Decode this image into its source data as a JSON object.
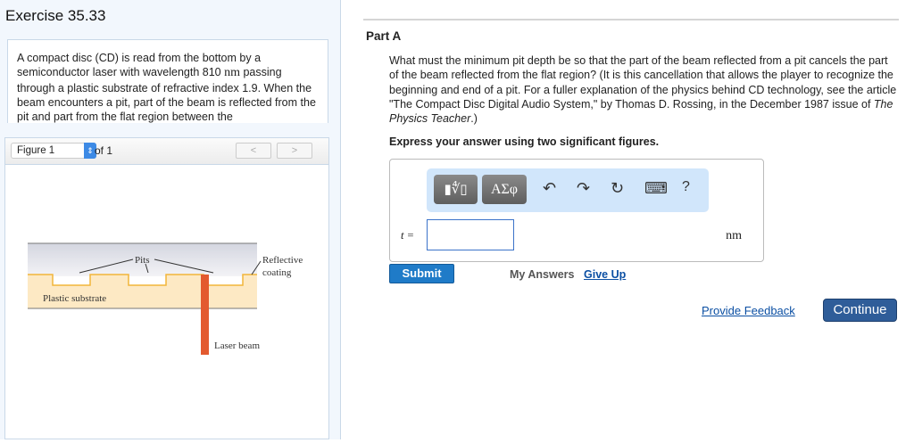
{
  "left": {
    "title": "Exercise 35.33",
    "intro_before": "A compact disc (CD) is read from the bottom by a semiconductor laser with wavelength 810 ",
    "intro_unit": "nm",
    "intro_after": " passing through a plastic substrate of refractive index 1.9. When the beam encounters a pit, part of the beam is reflected from the pit and part from the flat region between the",
    "figure": {
      "selected": "Figure 1",
      "of_label": "of 1",
      "prev": "<",
      "next": ">",
      "labels": {
        "pits": "Pits",
        "reflective": "Reflective",
        "coating": "coating",
        "substrate": "Plastic substrate",
        "laser": "Laser beam"
      }
    }
  },
  "part": {
    "title": "Part A",
    "question_main": "What must the minimum pit depth be so that the part of the beam reflected from a pit cancels the part of the beam reflected from the flat region? (It is this cancellation that allows the player to recognize the beginning and end of a pit. For a fuller explanation of the physics behind CD technology, see the article \"The Compact Disc Digital Audio System,\" by Thomas D. Rossing, in the December 1987 issue of ",
    "question_journal": "The Physics Teacher",
    "question_end": ".)",
    "instruction": "Express your answer using two significant figures.",
    "toolbar": {
      "templates": "▮∜▯",
      "greek": "ΑΣφ",
      "undo": "↶",
      "redo": "↷",
      "reset": "↻",
      "keyboard": "⌨",
      "help": "?"
    },
    "variable": "t =",
    "answer_value": "",
    "unit": "nm",
    "submit": "Submit",
    "my_answers": "My Answers",
    "give_up": "Give Up"
  },
  "footer": {
    "feedback": "Provide Feedback",
    "continue": "Continue"
  }
}
